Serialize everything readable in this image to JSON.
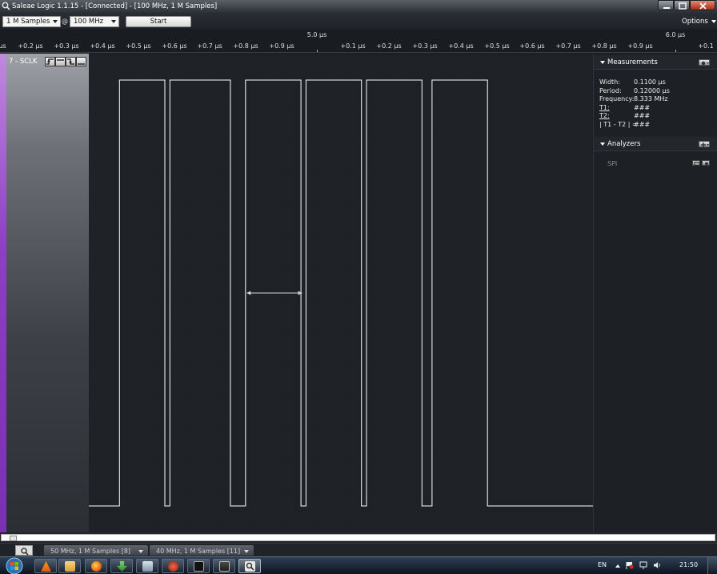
{
  "window": {
    "title": "Saleae Logic 1.1.15 - [Connected] - [100 MHz, 1 M Samples]",
    "icon": "magnifier-icon"
  },
  "toolbar": {
    "samples": "1 M Samples",
    "at_symbol": "@",
    "rate": "100 MHz",
    "start_label": "Start",
    "options_label": "Options"
  },
  "ruler": {
    "left_edge_label": "µs",
    "ticks_left": [
      "+0.2 µs",
      "+0.3 µs",
      "+0.4 µs",
      "+0.5 µs",
      "+0.6 µs",
      "+0.7 µs",
      "+0.8 µs",
      "+0.9 µs"
    ],
    "major_center": "5.0 µs",
    "ticks_right": [
      "+0.1 µs",
      "+0.2 µs",
      "+0.3 µs",
      "+0.4 µs",
      "+0.5 µs",
      "+0.6 µs",
      "+0.7 µs",
      "+0.8 µs",
      "+0.9 µs",
      "+0.1"
    ],
    "major_right": "6.0 µs"
  },
  "channel": {
    "label": "7 - SCLK",
    "color": "#8e3fc4",
    "trigger_icons": [
      "rising-edge-icon",
      "high-level-icon",
      "falling-edge-icon",
      "low-level-icon"
    ],
    "logic_high_pulses": [
      [
        0.06,
        0.15
      ],
      [
        0.16,
        0.28
      ],
      [
        0.31,
        0.42
      ],
      [
        0.43,
        0.54
      ],
      [
        0.55,
        0.66
      ],
      [
        0.68,
        0.79
      ]
    ],
    "measurement_marker": [
      0.31,
      0.42
    ]
  },
  "measurements": {
    "title": "Measurements",
    "rows": [
      {
        "label": "Width:",
        "value": "0.1100 µs"
      },
      {
        "label": "Period:",
        "value": "0.12000 µs"
      },
      {
        "label": "Frequency:",
        "value": "8.333 MHz"
      },
      {
        "label": "T1:",
        "value": "###"
      },
      {
        "label": "T2:",
        "value": "###"
      },
      {
        "label": "| T1 - T2 | =",
        "value": "###"
      }
    ]
  },
  "analyzers": {
    "title": "Analyzers",
    "items": [
      {
        "name": "SPI"
      }
    ]
  },
  "tabs": [
    {
      "label": "50 MHz, 1 M Samples [8]"
    },
    {
      "label": "40 MHz, 1 M Samples [11]"
    }
  ],
  "taskbar": {
    "language": "EN",
    "clock": "21:50"
  }
}
